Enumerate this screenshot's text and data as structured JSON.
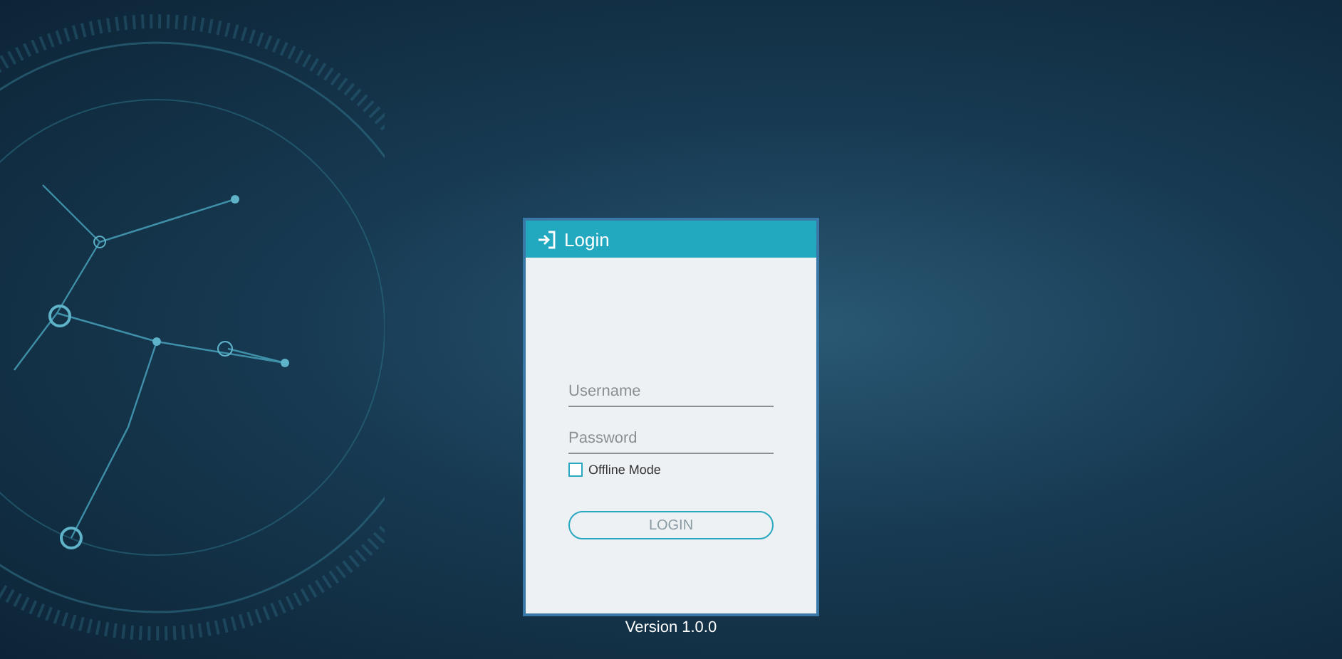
{
  "dialog": {
    "title": "Login"
  },
  "username": {
    "placeholder": "Username"
  },
  "password": {
    "placeholder": "Password"
  },
  "offline_mode": {
    "label": "Offline Mode",
    "checked": false
  },
  "login_button": {
    "label": "LOGIN"
  },
  "version": "Version 1.0.0"
}
